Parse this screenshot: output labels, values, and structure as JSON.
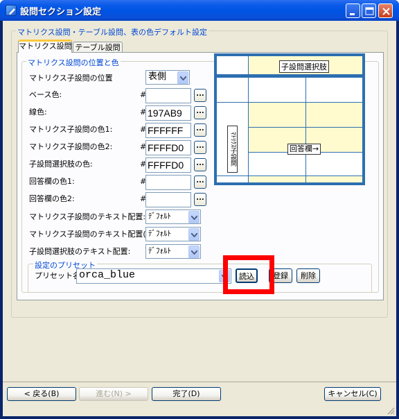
{
  "window": {
    "title": "設問セクション設定"
  },
  "outer_group": {
    "label": "マトリクス設問・テーブル設問、表の色デフォルト設定"
  },
  "tabs": [
    {
      "label": "マトリクス設問"
    },
    {
      "label": "テーブル設問"
    }
  ],
  "inner_group": {
    "label": "マトリクス設問の位置と色"
  },
  "position": {
    "label": "マトリクス子設問の位置",
    "value": "表側"
  },
  "colors": [
    {
      "label": "ベース色:",
      "value": ""
    },
    {
      "label": "線色:",
      "value": "197AB9"
    },
    {
      "label": "マトリクス子設問の色1:",
      "value": "FFFFFF"
    },
    {
      "label": "マトリクス子設問の色2:",
      "value": "FFFFD0"
    },
    {
      "label": "子設問選択肢の色:",
      "value": "FFFFD0"
    },
    {
      "label": "回答欄の色1:",
      "value": ""
    },
    {
      "label": "回答欄の色2:",
      "value": ""
    }
  ],
  "hash_symbol": "#",
  "browse_label": "...",
  "align": [
    {
      "label": "マトリクス子設問のテキスト配置:",
      "value": "ﾃﾞﾌｫﾙﾄ"
    },
    {
      "label": "マトリクス子設問のテキスト配置(右):",
      "value": "ﾃﾞﾌｫﾙﾄ"
    },
    {
      "label": "子設問選択肢のテキスト配置:",
      "value": "ﾃﾞﾌｫﾙﾄ"
    }
  ],
  "preset_group": {
    "label": "設定のプリセット"
  },
  "preset": {
    "label": "プリセット名:",
    "value": "orca_blue",
    "load": "読込",
    "register": "登録",
    "delete": "削除"
  },
  "preview": {
    "choice_header": "子設問選択肢",
    "sub_question": "ﾏﾄﾘｸｽ子設問",
    "answer": "回答欄→"
  },
  "footer": {
    "back": "< 戻る(B)",
    "next": "進む(N) >",
    "finish": "完了(D)",
    "cancel": "キャンセル(C)"
  },
  "colors_theme": {
    "title_bar": "#0054e3",
    "line": "#197AB9",
    "highlight": "#ff0000",
    "preview_fill": "#FFFFD0"
  }
}
